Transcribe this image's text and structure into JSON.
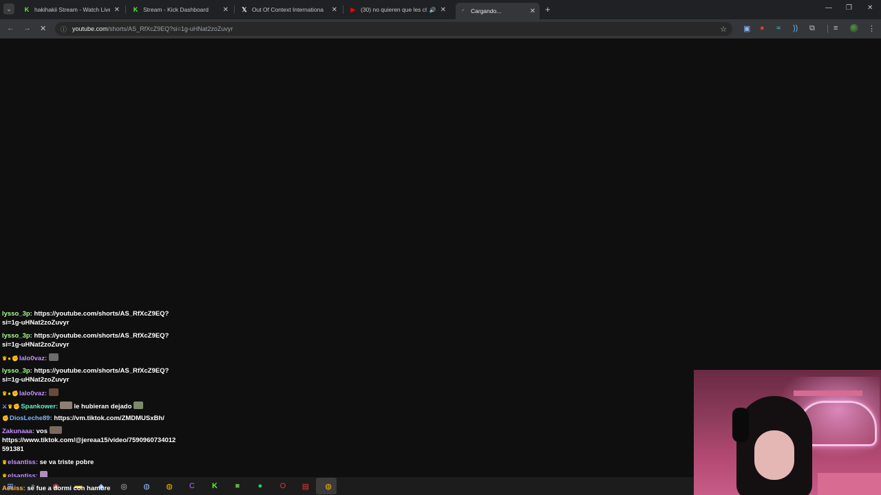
{
  "browser": {
    "tabs": [
      {
        "title": "hakihakii Stream - Watch Live o",
        "icon": "kick-icon",
        "active": false
      },
      {
        "title": "Stream - Kick Dashboard",
        "icon": "kick-icon",
        "active": false
      },
      {
        "title": "Out Of Context Internationa",
        "icon": "x-icon",
        "active": false
      },
      {
        "title": "(30) no quieren que les chu",
        "icon": "youtube-icon",
        "active": false,
        "audio": true
      },
      {
        "title": "Cargando...",
        "icon": "loading-icon",
        "active": true
      }
    ],
    "address": {
      "host": "youtube.com",
      "path": "/shorts/AS_RfXcZ9EQ?si=1g-uHNat2zoZuvyr"
    }
  },
  "chat": {
    "messages": [
      {
        "user": "lysso_3p:",
        "text": "https://youtube.com/shorts/AS_RfXcZ9EQ?",
        "cont": "si=1g-uHNat2zoZuvyr"
      },
      {
        "user": "lysso_3p:",
        "text": "https://youtube.com/shorts/AS_RfXcZ9EQ?",
        "cont": "si=1g-uHNat2zoZuvyr"
      },
      {
        "user": "lalo0vaz:",
        "text": ""
      },
      {
        "user": "lysso_3p:",
        "text": "https://youtube.com/shorts/AS_RfXcZ9EQ?",
        "cont": "si=1g-uHNat2zoZuvyr"
      },
      {
        "user": "lalo0vaz:",
        "text": ""
      },
      {
        "user": "Spankower:",
        "text": "le hubieran dejado"
      },
      {
        "user": "DiosLeche89:",
        "text": "https://vm.tiktok.com/ZMDMUSxBh/"
      },
      {
        "user": "Zakunaaa:",
        "text": "vos",
        "cont": "https://www.tiktok.com/@jereaa15/video/7590960734012",
        "cont2": "591381"
      },
      {
        "user": "elsantiss:",
        "text": "se va triste pobre"
      },
      {
        "user": "elsantiss:",
        "text": ""
      },
      {
        "user": "Aesiss:",
        "text": "se fue a dormi con hambre"
      }
    ]
  },
  "colors": {
    "tabstrip": "#202124",
    "toolbar": "#35363a",
    "page": "#0f0f0f",
    "chat_text": "#ffffff"
  }
}
